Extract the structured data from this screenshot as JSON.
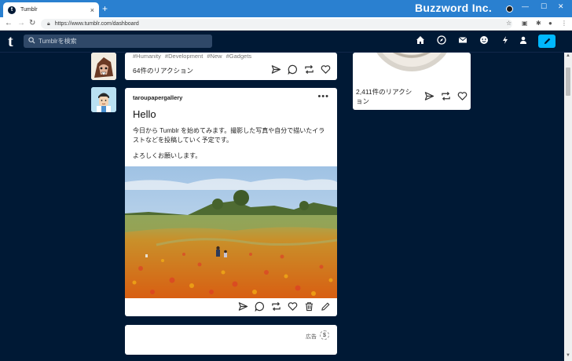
{
  "browser": {
    "tab_title": "Tumblr",
    "new_tab": "+",
    "brand": "Buzzword Inc.",
    "url": "https://www.tumblr.com/dashboard",
    "window_controls": [
      "—",
      "☐",
      "✕"
    ]
  },
  "header": {
    "logo": "t",
    "search_placeholder": "Tumblrを検索",
    "nav_icons": [
      "home-icon",
      "explore-icon",
      "inbox-icon",
      "messages-icon",
      "activity-icon",
      "account-icon",
      "compose-icon"
    ]
  },
  "posts": {
    "top": {
      "tags": "#Humanity  #Development  #New  #Gadgets",
      "reactions": "64件のリアクション"
    },
    "main": {
      "blog_name": "taroupapergallery",
      "more": "•••",
      "title": "Hello",
      "body_1": "今日から Tumblr を始めてみます。撮影した写真や自分で描いたイラストなどを投稿していく予定です。",
      "body_2": "よろしくお願いします。"
    },
    "ad": {
      "label": "広告",
      "icon": "$"
    }
  },
  "sidebar": {
    "reactions": "2,411件のリアクション"
  },
  "colors": {
    "tumblr_navy": "#001935",
    "accent_blue": "#00b8ff",
    "chrome_blue": "#2a80d0"
  }
}
